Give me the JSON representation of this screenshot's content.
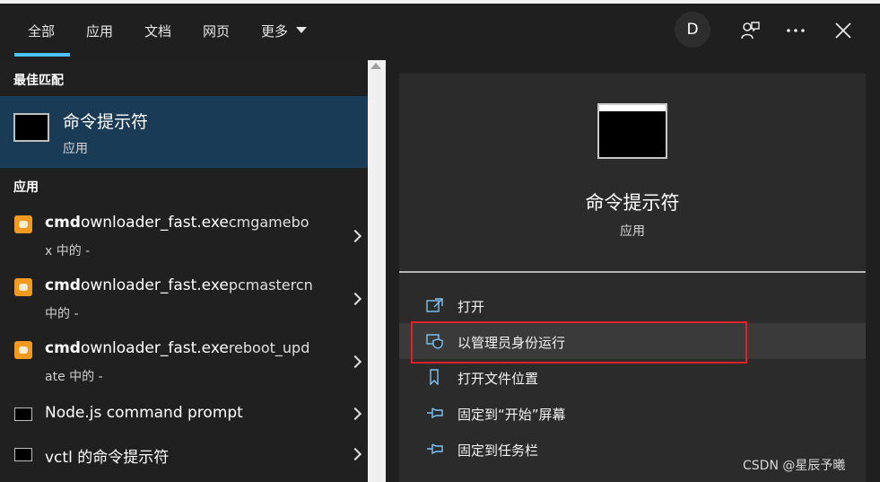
{
  "tabs": [
    "全部",
    "应用",
    "文档",
    "网页",
    "更多"
  ],
  "avatar_letter": "D",
  "best_match": {
    "header": "最佳匹配",
    "title": "命令提示符",
    "subtitle": "应用"
  },
  "apps": {
    "header": "应用",
    "items": [
      {
        "bold": "cmd",
        "name": "ownloader_fast.exe",
        "rest": "cmgamebo",
        "line2": "x 中的 -"
      },
      {
        "bold": "cmd",
        "name": "ownloader_fast.exe",
        "rest": "pcmastercn",
        "line2": "中的 -"
      },
      {
        "bold": "cmd",
        "name": "ownloader_fast.exe",
        "rest": "reboot_upd",
        "line2": "ate 中的 -"
      },
      {
        "title": "Node.js command prompt"
      },
      {
        "title": "vctl 的命令提示符"
      }
    ]
  },
  "detail": {
    "title": "命令提示符",
    "subtitle": "应用",
    "actions": [
      "打开",
      "以管理员身份运行",
      "打开文件位置",
      "固定到“开始”屏幕",
      "固定到任务栏"
    ]
  },
  "watermark": "CSDN @星辰予曦",
  "colors": {
    "accent": "#4cc2ff",
    "selected_bg": "#1a3b56",
    "highlight_border": "#e0202a"
  }
}
